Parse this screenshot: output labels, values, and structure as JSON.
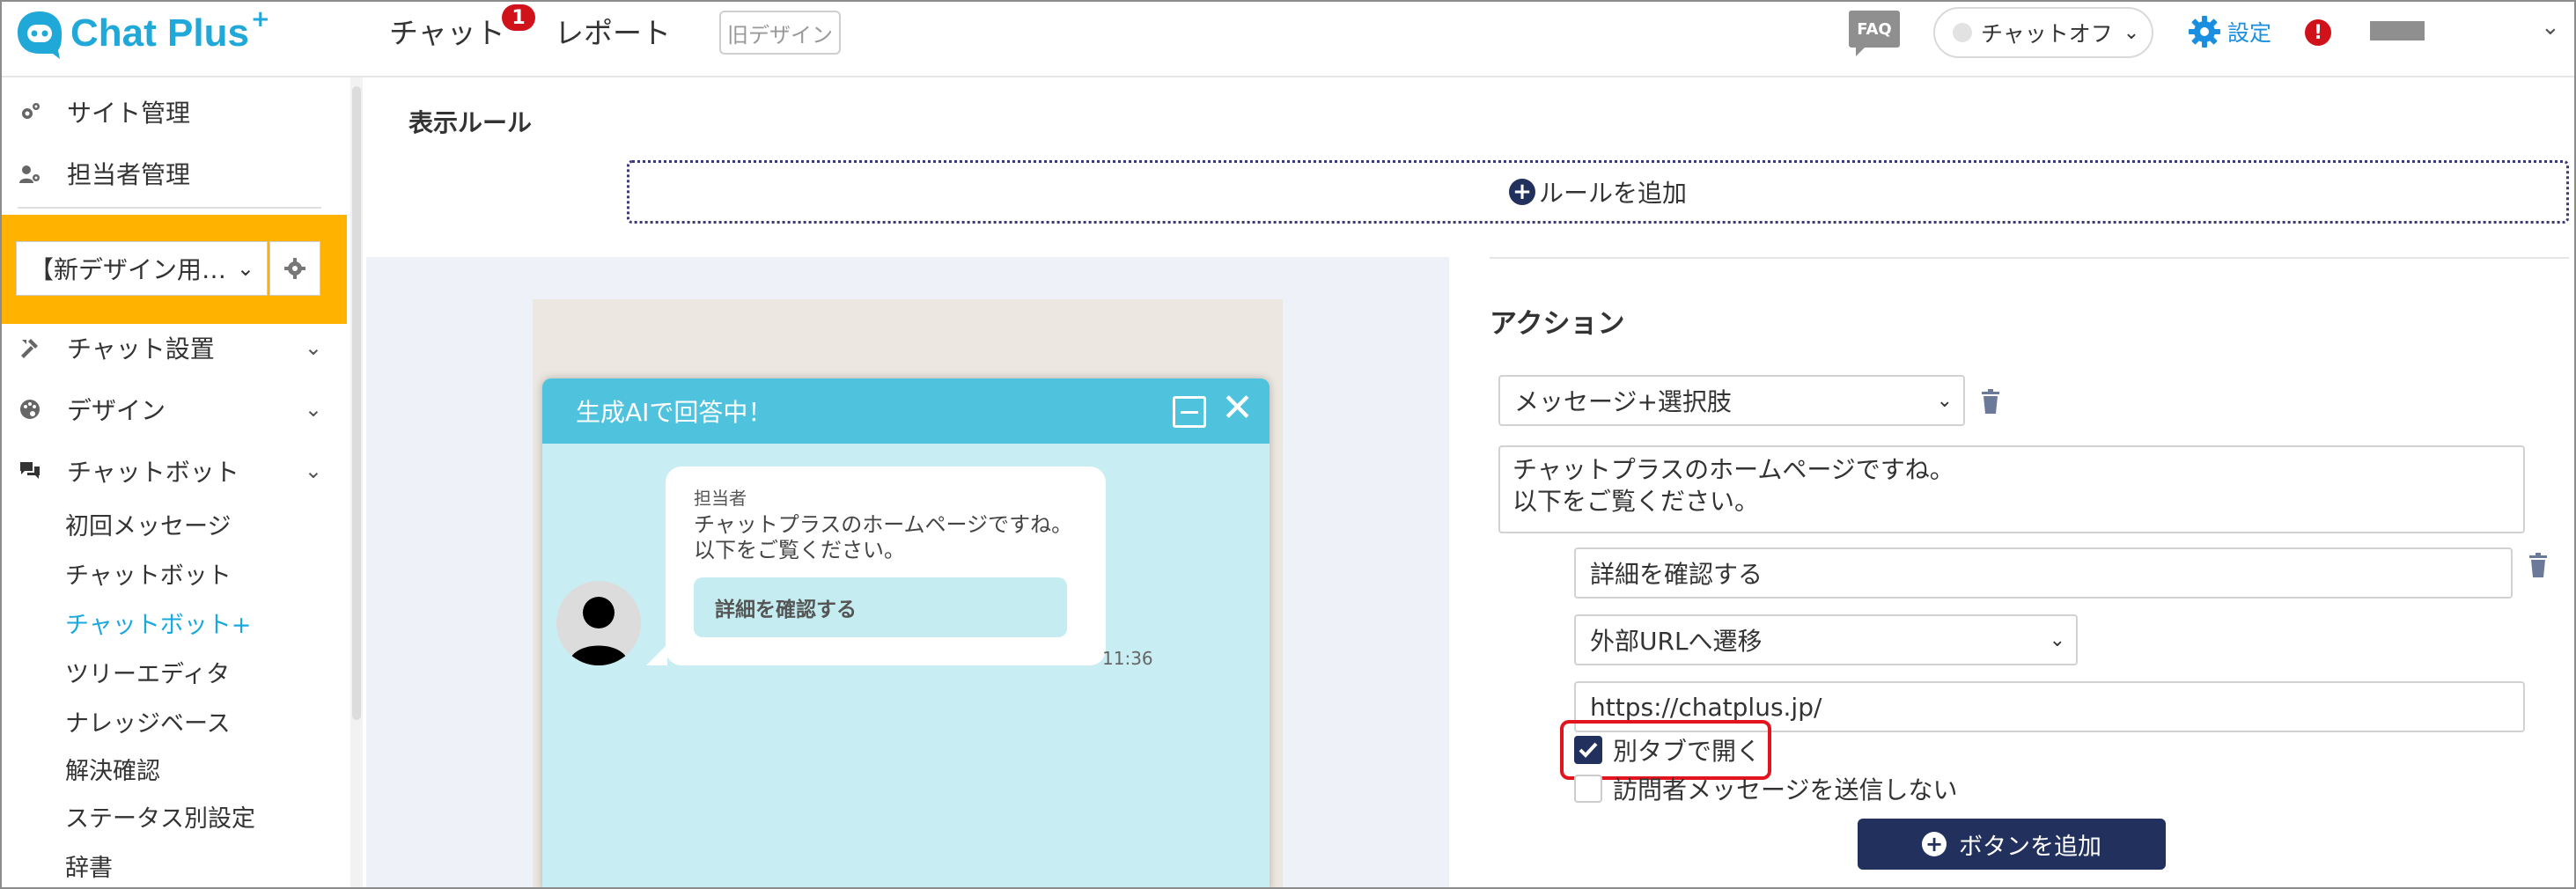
{
  "header": {
    "logo_text": "Chat Plus",
    "logo_plus": "+",
    "nav_chat": "チャット",
    "nav_chat_badge": "1",
    "nav_report": "レポート",
    "old_design": "旧デザイン",
    "faq": "FAQ",
    "chat_status": "チャットオフ",
    "settings": "設定",
    "alert": "!"
  },
  "sidebar": {
    "site_manage": "サイト管理",
    "staff_manage": "担当者管理",
    "site_select": "【新デザイン用…",
    "chat_setup": "チャット設置",
    "design": "デザイン",
    "chatbot": "チャットボット",
    "sub_items": [
      "初回メッセージ",
      "チャットボット",
      "チャットボット+",
      "ツリーエディタ",
      "ナレッジベース",
      "解決確認",
      "ステータス別設定",
      "辞書"
    ]
  },
  "rules": {
    "title": "表示ルール",
    "add_rule": "ルールを追加"
  },
  "preview": {
    "header_title": "生成AIで回答中！",
    "sender": "担当者",
    "message": "チャットプラスのホームページですね。\n以下をご覧ください。",
    "button_label": "詳細を確認する",
    "time": "11:36"
  },
  "action": {
    "title": "アクション",
    "type_select": "メッセージ+選択肢",
    "message_text": "チャットプラスのホームページですね。\n以下をご覧ください。",
    "button_text": "詳細を確認する",
    "transition_select": "外部URLへ遷移",
    "url": "https://chatplus.jp/",
    "open_new_tab": "別タブで開く",
    "open_new_tab_checked": true,
    "no_visitor_msg": "訪問者メッセージを送信しない",
    "no_visitor_msg_checked": false,
    "add_button": "ボタンを追加"
  },
  "colors": {
    "brand": "#1fa8d8",
    "navy": "#22305e",
    "sidebar_highlight": "#ffb300",
    "chat_header": "#4fc3de",
    "alert_red": "#d0121b"
  }
}
